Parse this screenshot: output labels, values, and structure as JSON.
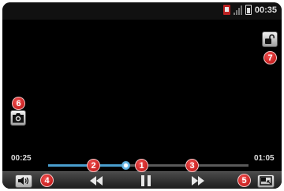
{
  "status_bar": {
    "time": "00:35",
    "icons": [
      "sim-icon",
      "signal-icon",
      "battery-icon"
    ]
  },
  "player": {
    "current_time": "00:25",
    "total_time": "01:05",
    "progress": 0.385
  },
  "badges": [
    "1",
    "2",
    "3",
    "4",
    "5",
    "6",
    "7"
  ],
  "icons": {
    "volume": "speaker-icon",
    "rewind": "rewind-icon",
    "play_pause": "pause-icon",
    "fast_forward": "fast-forward-icon",
    "fullscreen": "resize-screen-icon",
    "capture": "camera-capture-icon",
    "lock": "unlock-icon"
  },
  "colors": {
    "accent": "#4a9fd0",
    "badge": "#cc1a1a"
  }
}
